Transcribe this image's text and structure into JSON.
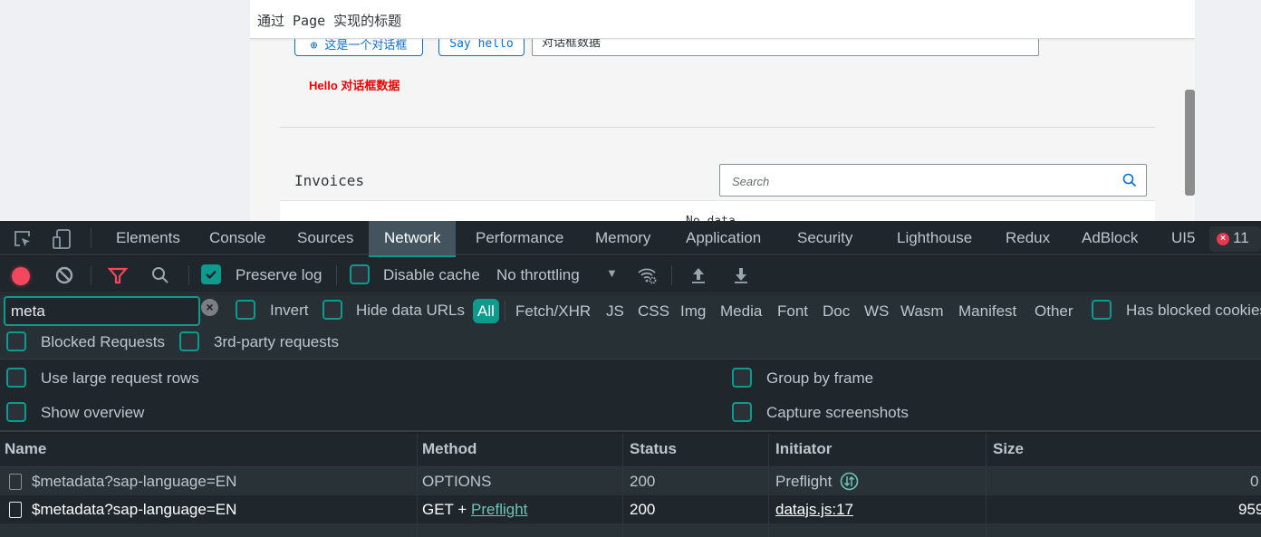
{
  "page": {
    "title": "通过 Page 实现的标题",
    "open_dialog_button": "⊕ 这是一个对话框",
    "say_hello_button": "Say hello",
    "dialog_input_value": "对话框数据",
    "hello_message": "Hello 对话框数据",
    "invoices": {
      "title": "Invoices",
      "search_placeholder": "Search",
      "no_data": "No data"
    }
  },
  "devtools": {
    "tabs": [
      {
        "label": "Elements",
        "active": false
      },
      {
        "label": "Console",
        "active": false
      },
      {
        "label": "Sources",
        "active": false
      },
      {
        "label": "Network",
        "active": true
      },
      {
        "label": "Performance",
        "active": false
      },
      {
        "label": "Memory",
        "active": false
      },
      {
        "label": "Application",
        "active": false
      },
      {
        "label": "Security",
        "active": false
      },
      {
        "label": "Lighthouse",
        "active": false
      },
      {
        "label": "Redux",
        "active": false
      },
      {
        "label": "AdBlock",
        "active": false
      },
      {
        "label": "UI5",
        "active": false
      }
    ],
    "error_count": "11",
    "toolbar": {
      "preserve_log": {
        "label": "Preserve log",
        "checked": true
      },
      "disable_cache": {
        "label": "Disable cache",
        "checked": false
      },
      "throttling": "No throttling"
    },
    "filter": {
      "value": "meta",
      "invert": {
        "label": "Invert",
        "checked": false
      },
      "hide_data_urls": {
        "label": "Hide data URLs",
        "checked": false
      },
      "types": [
        "All",
        "Fetch/XHR",
        "JS",
        "CSS",
        "Img",
        "Media",
        "Font",
        "Doc",
        "WS",
        "Wasm",
        "Manifest",
        "Other"
      ],
      "active_type": "All",
      "has_blocked_cookies": {
        "label": "Has blocked cookies",
        "checked": false
      },
      "blocked_requests": {
        "label": "Blocked Requests",
        "checked": false
      },
      "third_party": {
        "label": "3rd-party requests",
        "checked": false
      }
    },
    "settings": {
      "large_rows": {
        "label": "Use large request rows",
        "checked": false
      },
      "show_overview": {
        "label": "Show overview",
        "checked": false
      },
      "group_by_frame": {
        "label": "Group by frame",
        "checked": false
      },
      "capture_screenshots": {
        "label": "Capture screenshots",
        "checked": false
      }
    },
    "table": {
      "columns": [
        "Name",
        "Method",
        "Status",
        "Initiator",
        "Size"
      ],
      "rows": [
        {
          "name": "$metadata?sap-language=EN",
          "method": "OPTIONS",
          "method_link": "",
          "status": "200",
          "initiator": "Preflight",
          "initiator_is_link": false,
          "size": "0"
        },
        {
          "name": "$metadata?sap-language=EN",
          "method": "GET + ",
          "method_link": "Preflight",
          "status": "200",
          "initiator": "datajs.js:17",
          "initiator_is_link": true,
          "size": "959"
        }
      ]
    },
    "colors": {
      "accent": "#0e9a8c",
      "record": "#f2475e",
      "error": "#e6384f",
      "link": "#6cc4b8"
    }
  }
}
